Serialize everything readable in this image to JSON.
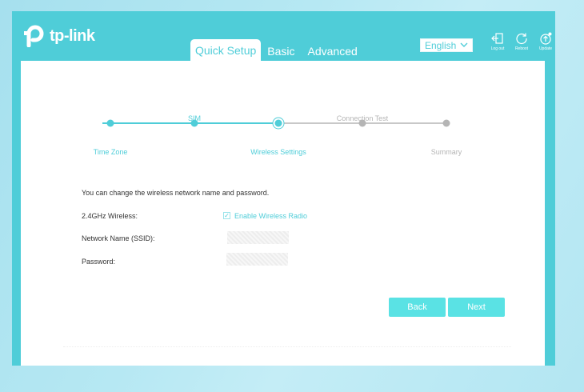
{
  "brand": {
    "name": "tp-link"
  },
  "nav": {
    "tabs": [
      {
        "label": "Quick Setup",
        "active": true
      },
      {
        "label": "Basic",
        "active": false
      },
      {
        "label": "Advanced",
        "active": false
      }
    ]
  },
  "header": {
    "language": "English",
    "icons": [
      {
        "icon": "logout-icon",
        "label": "Log out"
      },
      {
        "icon": "reboot-icon",
        "label": "Reboot"
      },
      {
        "icon": "update-icon",
        "label": "Update"
      }
    ]
  },
  "wizard": {
    "steps": [
      {
        "label": "Time Zone",
        "state": "done"
      },
      {
        "label": "SIM",
        "state": "done"
      },
      {
        "label": "Wireless Settings",
        "state": "current"
      },
      {
        "label": "Connection Test",
        "state": "pending"
      },
      {
        "label": "Summary",
        "state": "pending"
      }
    ]
  },
  "form": {
    "intro": "You can change the wireless network name and password.",
    "wireless_label": "2.4GHz Wireless:",
    "enable_label": "Enable Wireless Radio",
    "enable_checked": true,
    "ssid_label": "Network Name (SSID):",
    "ssid_value": "",
    "password_label": "Password:",
    "password_value": ""
  },
  "actions": {
    "back_label": "Back",
    "next_label": "Next"
  },
  "colors": {
    "accent": "#4fcdd8",
    "button": "#5ae2e4",
    "pending": "#b5b5b5"
  }
}
